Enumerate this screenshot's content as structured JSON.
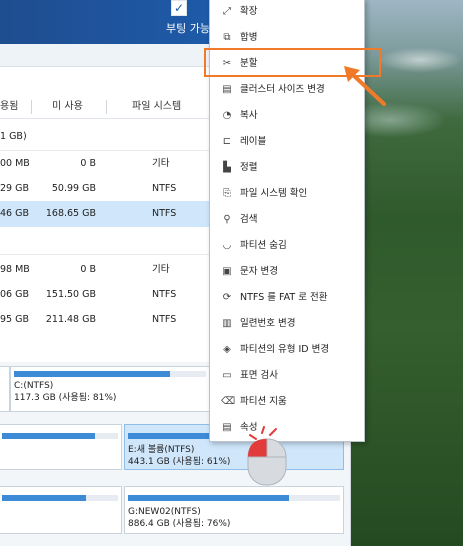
{
  "titlebar": {
    "boot_check": "✓",
    "boot_label": "부팅 가능한"
  },
  "table": {
    "headers": [
      "용됨",
      "미 사용",
      "파일 시스템"
    ],
    "group1_label": "1 GB)",
    "rows": [
      {
        "used": "00 MB",
        "unused": "0 B",
        "fs": "기타"
      },
      {
        "used": "29 GB",
        "unused": "50.99 GB",
        "fs": "NTFS"
      },
      {
        "used": "46 GB",
        "unused": "168.65 GB",
        "fs": "NTFS"
      },
      {
        "used": "98 MB",
        "unused": "0 B",
        "fs": "기타"
      },
      {
        "used": "06 GB",
        "unused": "151.50 GB",
        "fs": "NTFS"
      },
      {
        "used": "95 GB",
        "unused": "211.48 GB",
        "fs": "NTFS"
      }
    ]
  },
  "diskmap": {
    "partitions": [
      {
        "name": "C:(NTFS)",
        "detail": "117.3 GB (사용됨: 81%)",
        "used_fraction": 0.81
      },
      {
        "name": "E:새 볼륨(NTFS)",
        "detail": "443.1 GB (사용됨: 61%)",
        "used_fraction": 0.61
      },
      {
        "name": "G:NEW02(NTFS)",
        "detail": "886.4 GB (사용됨: 76%)",
        "used_fraction": 0.76
      }
    ]
  },
  "context_menu": {
    "items": [
      {
        "label": "확장",
        "icon": "expand-icon"
      },
      {
        "label": "합병",
        "icon": "merge-icon"
      },
      {
        "label": "분할",
        "icon": "split-icon"
      },
      {
        "label": "클러스터 사이즈 변경",
        "icon": "cluster-icon"
      },
      {
        "label": "복사",
        "icon": "copy-icon"
      },
      {
        "label": "레이블",
        "icon": "label-icon"
      },
      {
        "label": "정렬",
        "icon": "align-icon"
      },
      {
        "label": "파일 시스템 확인",
        "icon": "filesystem-check-icon"
      },
      {
        "label": "검색",
        "icon": "search-icon"
      },
      {
        "label": "파티션 숨김",
        "icon": "hide-icon"
      },
      {
        "label": "문자 변경",
        "icon": "letter-icon"
      },
      {
        "label": "NTFS 를 FAT 로 전환",
        "icon": "convert-icon"
      },
      {
        "label": "일련번호 변경",
        "icon": "serial-icon"
      },
      {
        "label": "파티션의 유형 ID 변경",
        "icon": "type-id-icon"
      },
      {
        "label": "표면 검사",
        "icon": "surface-test-icon"
      },
      {
        "label": "파티션 지움",
        "icon": "wipe-icon"
      },
      {
        "label": "속성",
        "icon": "properties-icon"
      }
    ],
    "highlighted_item": "분할"
  },
  "colors": {
    "titlebar": "#1e5aa8",
    "selection": "#cfe6fb",
    "usage_bar": "#3d8ad6",
    "highlight_border": "#f07a2a"
  }
}
